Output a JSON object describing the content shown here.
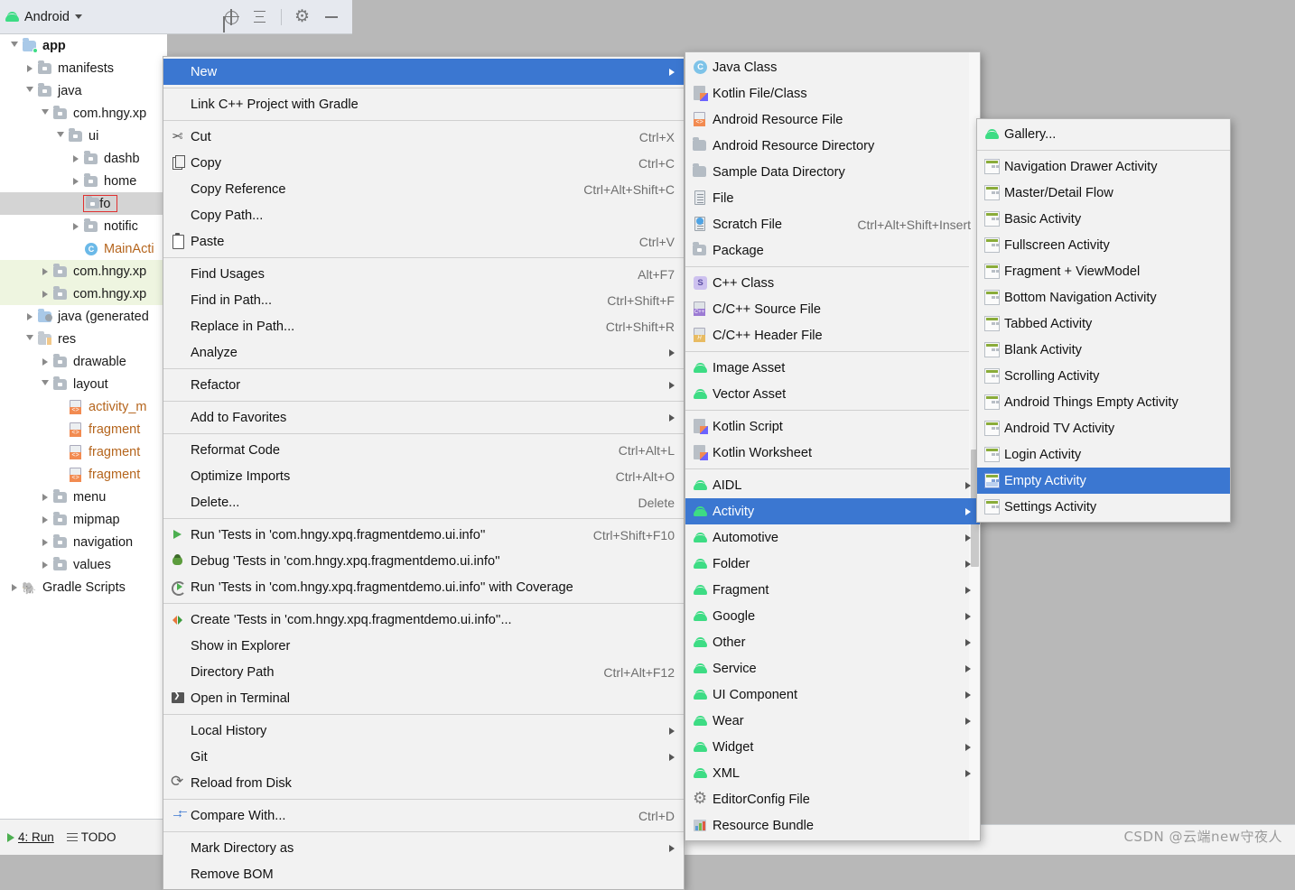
{
  "panel": {
    "title": "Android",
    "icons": [
      "locate-icon",
      "collapse-all-icon",
      "settings-icon",
      "minimize-icon"
    ]
  },
  "tree": [
    {
      "label": "app",
      "indent": 0,
      "arrow": "open",
      "icon": "module-folder",
      "bold": true
    },
    {
      "label": "manifests",
      "indent": 1,
      "arrow": "closed",
      "icon": "folder"
    },
    {
      "label": "java",
      "indent": 1,
      "arrow": "open",
      "icon": "folder"
    },
    {
      "label": "com.hngy.xp",
      "indent": 2,
      "arrow": "open",
      "icon": "folder-pkg"
    },
    {
      "label": "ui",
      "indent": 3,
      "arrow": "open",
      "icon": "folder-pkg"
    },
    {
      "label": "dashb",
      "indent": 4,
      "arrow": "closed",
      "icon": "folder-pkg"
    },
    {
      "label": "home",
      "indent": 4,
      "arrow": "closed",
      "icon": "folder-pkg"
    },
    {
      "label": "info",
      "indent": 4,
      "arrow": "none",
      "icon": "folder-pkg",
      "selected": true,
      "outlined": true
    },
    {
      "label": "notific",
      "indent": 4,
      "arrow": "closed",
      "icon": "folder-pkg"
    },
    {
      "label": "MainActi",
      "indent": 4,
      "arrow": "none",
      "icon": "java-class",
      "orange": true
    },
    {
      "label": "com.hngy.xp",
      "indent": 2,
      "arrow": "closed",
      "icon": "folder-pkg",
      "tinted": true
    },
    {
      "label": "com.hngy.xp",
      "indent": 2,
      "arrow": "closed",
      "icon": "folder-pkg",
      "tinted": true
    },
    {
      "label": "java (generated",
      "indent": 1,
      "arrow": "closed",
      "icon": "folder-generated"
    },
    {
      "label": "res",
      "indent": 1,
      "arrow": "open",
      "icon": "folder-res"
    },
    {
      "label": "drawable",
      "indent": 2,
      "arrow": "closed",
      "icon": "folder-pkg"
    },
    {
      "label": "layout",
      "indent": 2,
      "arrow": "open",
      "icon": "folder-pkg"
    },
    {
      "label": "activity_m",
      "indent": 3,
      "arrow": "none",
      "icon": "xml-file",
      "orange": true
    },
    {
      "label": "fragment",
      "indent": 3,
      "arrow": "none",
      "icon": "xml-file",
      "orange": true
    },
    {
      "label": "fragment",
      "indent": 3,
      "arrow": "none",
      "icon": "xml-file",
      "orange": true
    },
    {
      "label": "fragment",
      "indent": 3,
      "arrow": "none",
      "icon": "xml-file",
      "orange": true
    },
    {
      "label": "menu",
      "indent": 2,
      "arrow": "closed",
      "icon": "folder-pkg"
    },
    {
      "label": "mipmap",
      "indent": 2,
      "arrow": "closed",
      "icon": "folder-pkg"
    },
    {
      "label": "navigation",
      "indent": 2,
      "arrow": "closed",
      "icon": "folder-pkg"
    },
    {
      "label": "values",
      "indent": 2,
      "arrow": "closed",
      "icon": "folder-pkg"
    },
    {
      "label": "Gradle Scripts",
      "indent": 0,
      "arrow": "closed",
      "icon": "gradle"
    }
  ],
  "context_menu": [
    {
      "label": "New",
      "arrow": true,
      "highlighted": true
    },
    {
      "sep": true
    },
    {
      "label": "Link C++ Project with Gradle"
    },
    {
      "sep": true
    },
    {
      "label": "Cut",
      "key": "Ctrl+X",
      "icon": "cut-icon"
    },
    {
      "label": "Copy",
      "key": "Ctrl+C",
      "icon": "copy-icon"
    },
    {
      "label": "Copy Reference",
      "key": "Ctrl+Alt+Shift+C"
    },
    {
      "label": "Copy Path..."
    },
    {
      "label": "Paste",
      "key": "Ctrl+V",
      "icon": "paste-icon"
    },
    {
      "sep": true
    },
    {
      "label": "Find Usages",
      "key": "Alt+F7"
    },
    {
      "label": "Find in Path...",
      "key": "Ctrl+Shift+F"
    },
    {
      "label": "Replace in Path...",
      "key": "Ctrl+Shift+R"
    },
    {
      "label": "Analyze",
      "arrow": true
    },
    {
      "sep": true
    },
    {
      "label": "Refactor",
      "arrow": true
    },
    {
      "sep": true
    },
    {
      "label": "Add to Favorites",
      "arrow": true
    },
    {
      "sep": true
    },
    {
      "label": "Reformat Code",
      "key": "Ctrl+Alt+L"
    },
    {
      "label": "Optimize Imports",
      "key": "Ctrl+Alt+O"
    },
    {
      "label": "Delete...",
      "key": "Delete"
    },
    {
      "sep": true
    },
    {
      "label": "Run 'Tests in 'com.hngy.xpq.fragmentdemo.ui.info''",
      "key": "Ctrl+Shift+F10",
      "icon": "run-icon"
    },
    {
      "label": "Debug 'Tests in 'com.hngy.xpq.fragmentdemo.ui.info''",
      "icon": "debug-icon"
    },
    {
      "label": "Run 'Tests in 'com.hngy.xpq.fragmentdemo.ui.info'' with Coverage",
      "icon": "coverage-icon"
    },
    {
      "sep": true
    },
    {
      "label": "Create 'Tests in 'com.hngy.xpq.fragmentdemo.ui.info''...",
      "icon": "create-icon"
    },
    {
      "label": "Show in Explorer"
    },
    {
      "label": "Directory Path",
      "key": "Ctrl+Alt+F12"
    },
    {
      "label": "Open in Terminal",
      "icon": "terminal-icon"
    },
    {
      "sep": true
    },
    {
      "label": "Local History",
      "arrow": true
    },
    {
      "label": "Git",
      "arrow": true
    },
    {
      "label": "Reload from Disk",
      "icon": "reload-icon"
    },
    {
      "sep": true
    },
    {
      "label": "Compare With...",
      "key": "Ctrl+D",
      "icon": "compare-icon"
    },
    {
      "sep": true
    },
    {
      "label": "Mark Directory as",
      "arrow": true
    },
    {
      "label": "Remove BOM"
    }
  ],
  "new_menu": [
    {
      "label": "Java Class",
      "icon": "java-class-icon"
    },
    {
      "label": "Kotlin File/Class",
      "icon": "kotlin-icon"
    },
    {
      "label": "Android Resource File",
      "icon": "xml-icon"
    },
    {
      "label": "Android Resource Directory",
      "icon": "folder-icon"
    },
    {
      "label": "Sample Data Directory",
      "icon": "folder-icon"
    },
    {
      "label": "File",
      "icon": "file-icon"
    },
    {
      "label": "Scratch File",
      "key": "Ctrl+Alt+Shift+Insert",
      "icon": "scratch-file-icon"
    },
    {
      "label": "Package",
      "icon": "package-icon"
    },
    {
      "sep": true
    },
    {
      "label": "C++ Class",
      "icon": "cpp-class-icon"
    },
    {
      "label": "C/C++ Source File",
      "icon": "c-source-icon"
    },
    {
      "label": "C/C++ Header File",
      "icon": "c-header-icon"
    },
    {
      "sep": true
    },
    {
      "label": "Image Asset",
      "icon": "android-icon"
    },
    {
      "label": "Vector Asset",
      "icon": "android-icon"
    },
    {
      "sep": true
    },
    {
      "label": "Kotlin Script",
      "icon": "kotlin-icon"
    },
    {
      "label": "Kotlin Worksheet",
      "icon": "kotlin-icon"
    },
    {
      "sep": true
    },
    {
      "label": "AIDL",
      "icon": "android-icon",
      "arrow": true
    },
    {
      "label": "Activity",
      "icon": "android-icon",
      "arrow": true,
      "highlighted": true
    },
    {
      "label": "Automotive",
      "icon": "android-icon",
      "arrow": true
    },
    {
      "label": "Folder",
      "icon": "android-icon",
      "arrow": true
    },
    {
      "label": "Fragment",
      "icon": "android-icon",
      "arrow": true
    },
    {
      "label": "Google",
      "icon": "android-icon",
      "arrow": true
    },
    {
      "label": "Other",
      "icon": "android-icon",
      "arrow": true
    },
    {
      "label": "Service",
      "icon": "android-icon",
      "arrow": true
    },
    {
      "label": "UI Component",
      "icon": "android-icon",
      "arrow": true
    },
    {
      "label": "Wear",
      "icon": "android-icon",
      "arrow": true
    },
    {
      "label": "Widget",
      "icon": "android-icon",
      "arrow": true
    },
    {
      "label": "XML",
      "icon": "android-icon",
      "arrow": true
    },
    {
      "label": "EditorConfig File",
      "icon": "gear-icon"
    },
    {
      "label": "Resource Bundle",
      "icon": "resource-bundle-icon"
    }
  ],
  "activity_menu": [
    {
      "label": "Gallery...",
      "icon": "android-icon"
    },
    {
      "sep": true
    },
    {
      "label": "Navigation Drawer Activity",
      "icon": "template-icon"
    },
    {
      "label": "Master/Detail Flow",
      "icon": "template-icon"
    },
    {
      "label": "Basic Activity",
      "icon": "template-icon"
    },
    {
      "label": "Fullscreen Activity",
      "icon": "template-icon"
    },
    {
      "label": "Fragment + ViewModel",
      "icon": "template-icon"
    },
    {
      "label": "Bottom Navigation Activity",
      "icon": "template-icon"
    },
    {
      "label": "Tabbed Activity",
      "icon": "template-icon"
    },
    {
      "label": "Blank Activity",
      "icon": "template-icon"
    },
    {
      "label": "Scrolling Activity",
      "icon": "template-icon"
    },
    {
      "label": "Android Things Empty Activity",
      "icon": "template-icon"
    },
    {
      "label": "Android TV Activity",
      "icon": "template-icon"
    },
    {
      "label": "Login Activity",
      "icon": "template-icon"
    },
    {
      "label": "Empty Activity",
      "icon": "template-icon-filled",
      "highlighted": true
    },
    {
      "label": "Settings Activity",
      "icon": "template-icon"
    }
  ],
  "statusbar": {
    "run_label": "4: Run",
    "todo_label": "TODO"
  },
  "watermark": "CSDN @云端new守夜人",
  "colors": {
    "highlight": "#3b77d1",
    "menu_bg": "#f2f2f2",
    "panel_header": "#e6e9ef",
    "desktop": "#b8b8b8",
    "android_green": "#3ddc84",
    "outline_red": "#e03131"
  }
}
